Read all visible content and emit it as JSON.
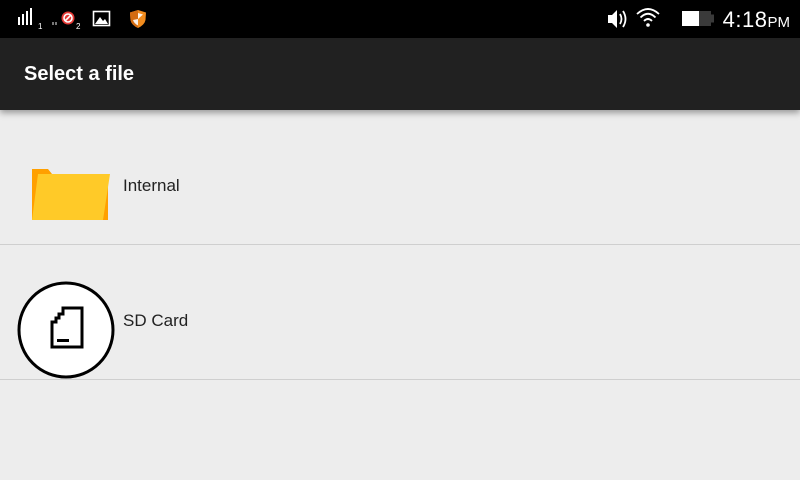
{
  "status_bar": {
    "icons": [
      "signal-sim1-icon",
      "signal-sim2-blocked-icon",
      "gallery-icon",
      "security-shield-icon",
      "volume-icon",
      "wifi-icon",
      "battery-icon"
    ],
    "sim1_index": "1",
    "sim2_index": "2",
    "time": "4:18",
    "ampm": "PM"
  },
  "toolbar": {
    "title": "Select a file"
  },
  "storage_list": {
    "items": [
      {
        "label": "Internal",
        "icon": "folder-icon"
      },
      {
        "label": "SD Card",
        "icon": "sd-card-icon"
      }
    ]
  },
  "colors": {
    "status_bar_bg": "#000000",
    "toolbar_bg": "#212121",
    "list_bg": "#ededed",
    "divider": "#cfcfcf",
    "folder_front": "#ffca28",
    "folder_back": "#ffa000",
    "shield_orange": "#f28c1e"
  }
}
